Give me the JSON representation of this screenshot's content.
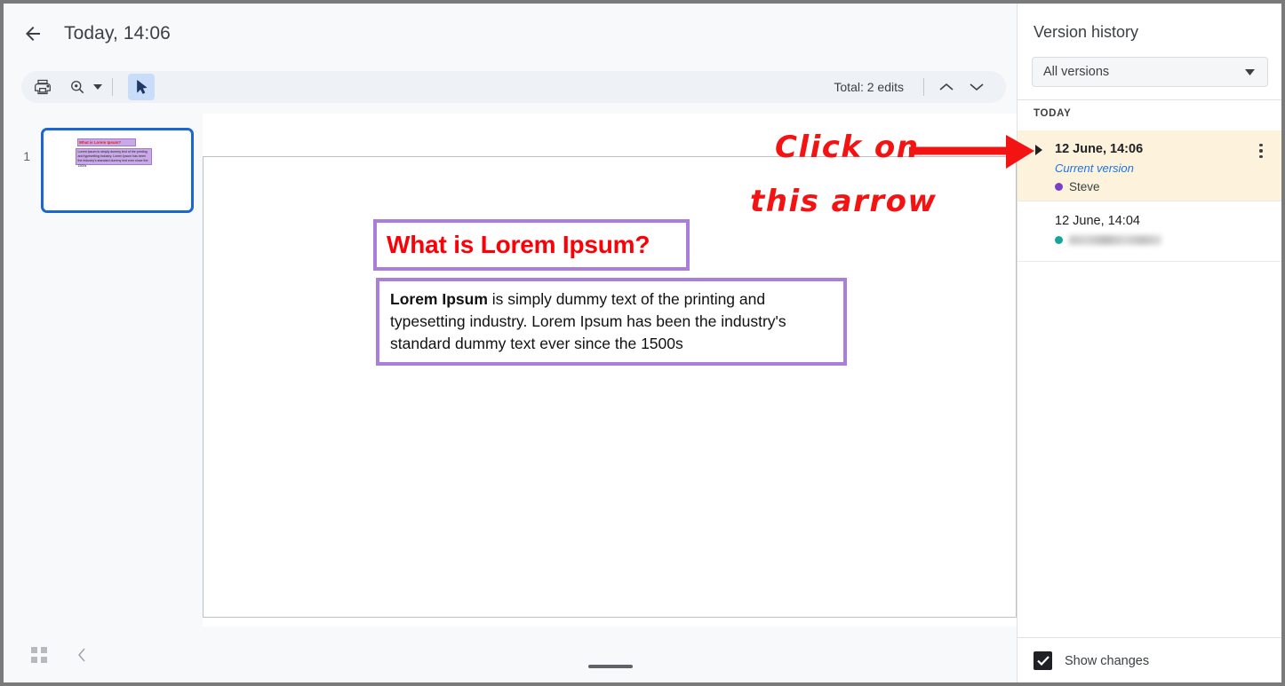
{
  "header": {
    "back_icon": "arrow-left-icon",
    "title": "Today, 14:06"
  },
  "toolbar": {
    "print_icon": "printer-icon",
    "zoom_icon": "zoom-magnifier-icon",
    "zoom_caret_icon": "chevron-down-icon",
    "cursor_icon": "cursor-select-icon",
    "edit_count": "Total: 2 edits",
    "prev_icon": "chevron-up-icon",
    "next_icon": "chevron-down-icon"
  },
  "thumbnails": {
    "items": [
      {
        "number": "1",
        "title": "What is Lorem Ipsum?",
        "body": "Lorem Ipsum is simply dummy text of the printing and typesetting industry. Lorem Ipsum has been the industry's standard dummy text ever since the 1500s"
      }
    ]
  },
  "slide": {
    "title": "What is Lorem Ipsum?",
    "body_bold": "Lorem Ipsum",
    "body_rest": " is simply dummy text of the printing and typesetting industry. Lorem Ipsum has been the industry's standard dummy text ever since the 1500s",
    "title_color": "#fb0007",
    "box_border_color": "#a97fdb"
  },
  "annotation": {
    "line1": "Click on",
    "line2": "this arrow",
    "color": "#f41313",
    "arrow_icon": "red-pointer-arrow"
  },
  "bottom_bar": {
    "grid_icon": "grid-view-icon",
    "collapse_icon": "chevron-left-icon",
    "resize_handle": "resize-handle"
  },
  "version_panel": {
    "title": "Version history",
    "filter": {
      "selected": "All versions",
      "caret_icon": "chevron-down-icon"
    },
    "day_label": "TODAY",
    "versions": [
      {
        "date": "12 June, 14:06",
        "status": "Current version",
        "author": "Steve",
        "author_dot_color": "#7a3fc7",
        "expand_icon": "triangle-right-icon",
        "menu_icon": "more-vert-icon",
        "selected": true
      },
      {
        "date": "12 June, 14:04",
        "status": "",
        "author": "",
        "author_dot_color": "#16a596",
        "author_blurred": true,
        "expand_icon": "",
        "menu_icon": "",
        "selected": false
      }
    ],
    "footer": {
      "show_changes_label": "Show changes",
      "show_changes_checked": true,
      "check_icon": "checkmark-icon"
    },
    "highlight_color": "#fdf3dd"
  }
}
